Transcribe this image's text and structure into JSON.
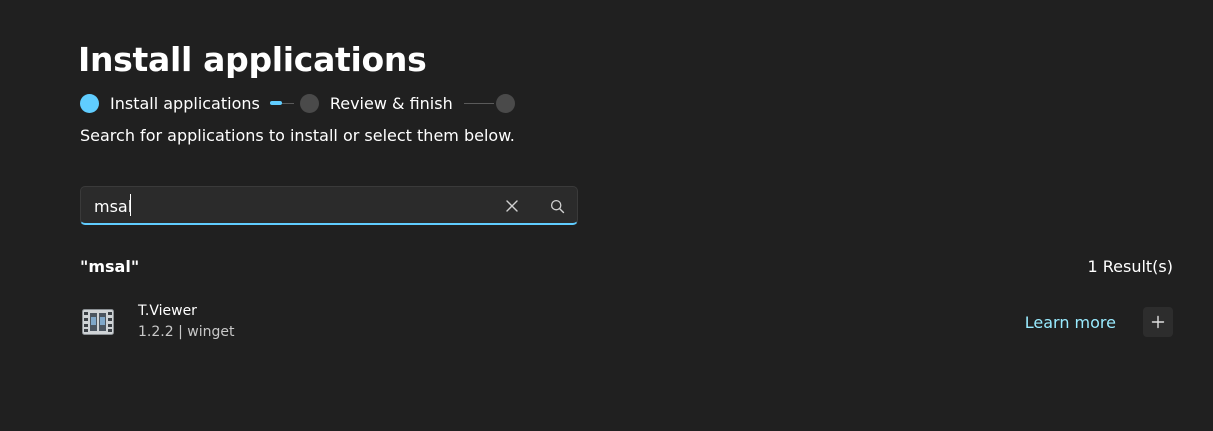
{
  "header": {
    "title": "Install applications",
    "subtitle": "Search for applications to install or select them below."
  },
  "stepper": {
    "steps": [
      {
        "label": "Install applications",
        "state": "active"
      },
      {
        "label": "Review & finish",
        "state": "pending"
      },
      {
        "label": "",
        "state": "pending"
      }
    ],
    "accent_color": "#60cdff",
    "inactive_color": "#4a4a4a"
  },
  "search": {
    "value": "msal",
    "clear_icon": "close-icon",
    "search_icon": "search-icon"
  },
  "results": {
    "query_label": "\"msal\"",
    "count_label": "1 Result(s)",
    "items": [
      {
        "name": "T.Viewer",
        "meta": "1.2.2 | winget",
        "icon": "film-strip-icon",
        "learn_more_label": "Learn more",
        "add_icon": "plus-icon"
      }
    ]
  },
  "colors": {
    "background": "#202020",
    "accent": "#60cdff",
    "link": "#99ebff"
  }
}
